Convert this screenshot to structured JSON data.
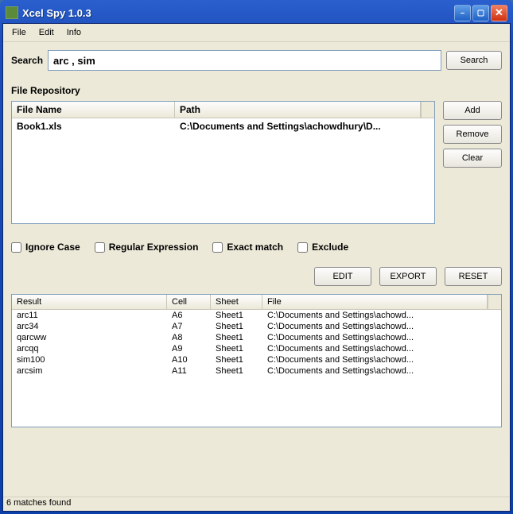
{
  "window": {
    "title": "Xcel Spy 1.0.3"
  },
  "menu": {
    "items": [
      "File",
      "Edit",
      "Info"
    ]
  },
  "search": {
    "label": "Search",
    "value": "arc , sim",
    "button": "Search"
  },
  "repo": {
    "title": "File Repository",
    "columns": {
      "name": "File Name",
      "path": "Path"
    },
    "rows": [
      {
        "name": "Book1.xls",
        "path": "C:\\Documents and Settings\\achowdhury\\D..."
      }
    ],
    "buttons": {
      "add": "Add",
      "remove": "Remove",
      "clear": "Clear"
    }
  },
  "options": {
    "ignore_case": "Ignore Case",
    "regex": "Regular Expression",
    "exact": "Exact match",
    "exclude": "Exclude"
  },
  "actions": {
    "edit": "EDIT",
    "export": "EXPORT",
    "reset": "RESET"
  },
  "results": {
    "columns": {
      "result": "Result",
      "cell": "Cell",
      "sheet": "Sheet",
      "file": "File"
    },
    "rows": [
      {
        "result": "arc11",
        "cell": "A6",
        "sheet": "Sheet1",
        "file": "C:\\Documents and Settings\\achowd..."
      },
      {
        "result": "arc34",
        "cell": "A7",
        "sheet": "Sheet1",
        "file": "C:\\Documents and Settings\\achowd..."
      },
      {
        "result": "qarcww",
        "cell": "A8",
        "sheet": "Sheet1",
        "file": "C:\\Documents and Settings\\achowd..."
      },
      {
        "result": "arcqq",
        "cell": "A9",
        "sheet": "Sheet1",
        "file": "C:\\Documents and Settings\\achowd..."
      },
      {
        "result": "sim100",
        "cell": "A10",
        "sheet": "Sheet1",
        "file": "C:\\Documents and Settings\\achowd..."
      },
      {
        "result": "arcsim",
        "cell": "A11",
        "sheet": "Sheet1",
        "file": "C:\\Documents and Settings\\achowd..."
      }
    ]
  },
  "status": "6 matches found"
}
